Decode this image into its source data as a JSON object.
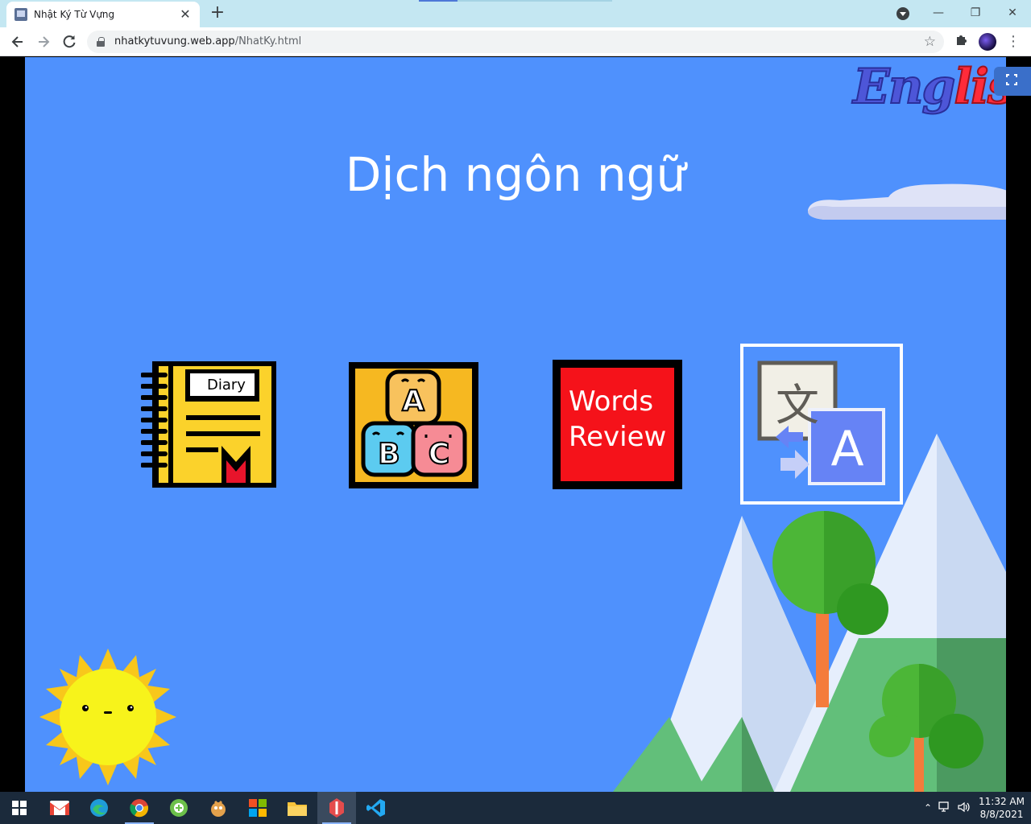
{
  "browser": {
    "tab_title": "Nhật Ký Từ Vựng",
    "tab_close": "✕",
    "new_tab": "+",
    "url_host": "nhatkytuvung.web.app",
    "url_path": "/NhatKy.html",
    "window_controls": {
      "minimize": "—",
      "restore": "❐",
      "close": "✕"
    }
  },
  "page": {
    "logo": {
      "part1": "Eng",
      "part2": "lish"
    },
    "title": "Dịch ngôn ngữ",
    "tiles": [
      {
        "name": "diary",
        "label": "Diary"
      },
      {
        "name": "alphabet-blocks",
        "letters": [
          "A",
          "B",
          "C"
        ]
      },
      {
        "name": "words-review",
        "line1": "Words",
        "line2": "Review"
      },
      {
        "name": "translate",
        "letters": [
          "文",
          "A"
        ],
        "selected": true
      }
    ]
  },
  "taskbar": {
    "apps": [
      "windows-start-icon",
      "gmail-icon",
      "edge-icon",
      "chrome-icon",
      "nox-icon",
      "game-icon",
      "office-icon",
      "file-explorer-icon",
      "app-icon",
      "vscode-icon"
    ],
    "time": "11:32 AM",
    "date": "8/8/2021"
  },
  "colors": {
    "stage_bg": "#4f91fd",
    "title": "#ffffff",
    "words_review_bg": "#f5121a",
    "taskbar": "#1b2a3b"
  }
}
